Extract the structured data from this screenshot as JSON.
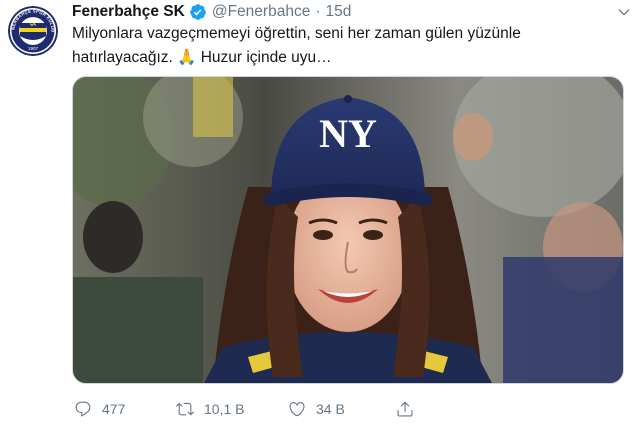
{
  "tweet": {
    "author_name": "Fenerbahçe SK",
    "handle": "@Fenerbahce",
    "separator": "·",
    "time": "15d",
    "verified": true,
    "text_line1": "Milyonlara vazgeçmemeyi öğrettin, seni her zaman gülen yüzünle",
    "text_line2": "hatırlayacağız. 🙏 Huzur içinde uyu…"
  },
  "avatar": {
    "icon": "fenerbahce-crest-icon",
    "crest_text": "FENERBAHÇE SPOR KULÜBÜ",
    "crest_year": "1907"
  },
  "media": {
    "cap_logo": "NY"
  },
  "actions": {
    "reply_count": "477",
    "retweet_count": "10,1 B",
    "like_count": "34 B"
  },
  "colors": {
    "text": "#14171a",
    "secondary": "#657786",
    "verified": "#1da1f2",
    "crest_blue": "#1f2b6c",
    "crest_yellow": "#f4d21f"
  }
}
